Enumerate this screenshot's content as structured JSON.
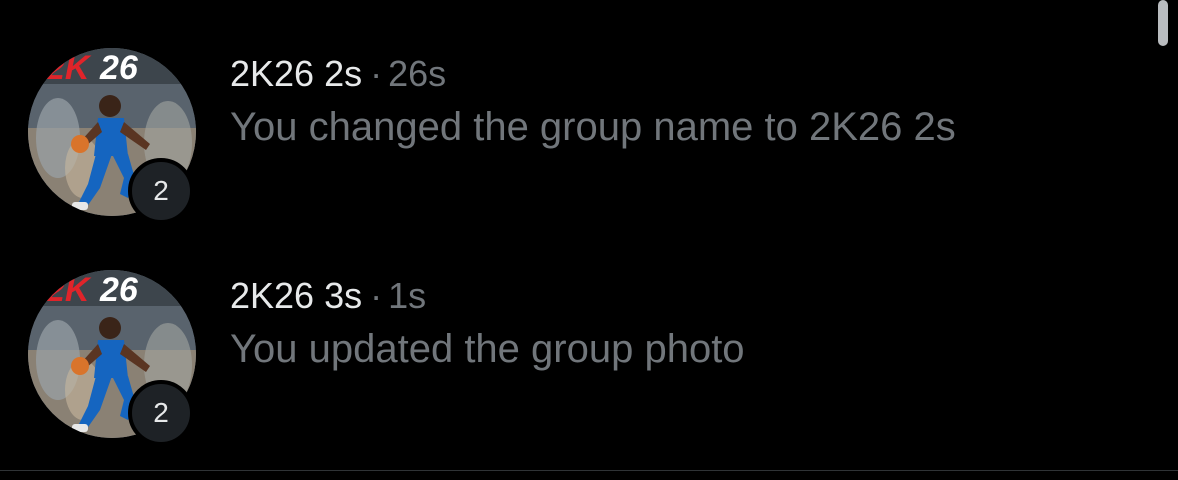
{
  "colors": {
    "background": "#000000",
    "primary_text": "#e7e9ea",
    "secondary_text": "#71767b",
    "badge_background": "#1e2226"
  },
  "conversations": [
    {
      "name": "2K26 2s",
      "separator": "·",
      "time": "26s",
      "preview": "You changed the group name to 2K26 2s",
      "avatar_logo": "2K26",
      "member_count": "2"
    },
    {
      "name": "2K26 3s",
      "separator": "·",
      "time": "1s",
      "preview": "You updated the group photo",
      "avatar_logo": "2K26",
      "member_count": "2"
    }
  ]
}
